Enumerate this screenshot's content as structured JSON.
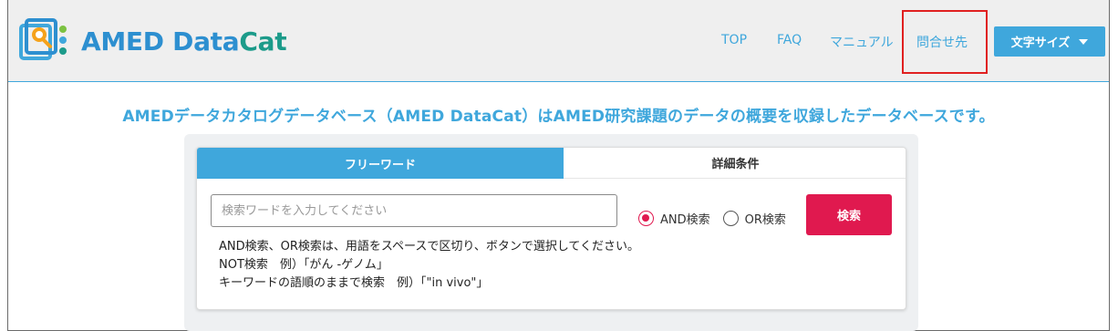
{
  "header": {
    "logo_text_1": "AMED Data",
    "logo_text_2": "Cat",
    "nav": [
      {
        "label": "TOP"
      },
      {
        "label": "FAQ"
      },
      {
        "label": "マニュアル"
      },
      {
        "label": "問合せ先"
      }
    ],
    "font_size_button": "文字サイズ"
  },
  "tagline": "AMEDデータカタログデータベース（AMED DataCat）はAMED研究課題のデータの概要を収録したデータベースです。",
  "search": {
    "tabs": [
      {
        "label": "フリーワード",
        "active": true
      },
      {
        "label": "詳細条件",
        "active": false
      }
    ],
    "input_placeholder": "検索ワードを入力してください",
    "input_value": "",
    "radio_and": "AND検索",
    "radio_or": "OR検索",
    "selected_mode": "AND",
    "button": "検索",
    "help": [
      "AND検索、OR検索は、用語をスペースで区切り、ボタンで選択してください。",
      "NOT検索　例）「がん -ゲノム」",
      "キーワードの語順のままで検索　例）「\"in vivo\"」"
    ]
  },
  "colors": {
    "accent": "#3fa7dc",
    "search_button": "#e0194f",
    "highlight_box": "#e02020"
  }
}
